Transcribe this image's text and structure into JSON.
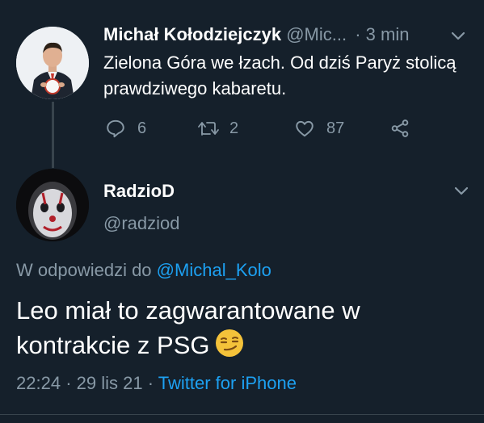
{
  "parent_tweet": {
    "author_name": "Michał Kołodziejczyk",
    "author_handle": "@Mic...",
    "time": "3 min",
    "text": "Zielona Góra we łzach. Od dziś Paryż stolicą prawdziwego kabaretu.",
    "replies": "6",
    "retweets": "2",
    "likes": "87"
  },
  "reply_tweet": {
    "author_name": "RadzioD",
    "author_handle": "@radziod",
    "reply_prefix": "W odpowiedzi do",
    "reply_to": "@Michal_Kolo",
    "text": "Leo miał to zagwarantowane w kontrakcie z PSG",
    "time": "22:24",
    "date": "29 lis 21",
    "source": "Twitter for iPhone",
    "separator": "·"
  },
  "colors": {
    "background": "#15202b",
    "muted": "#8899a6",
    "link": "#1da1f2",
    "divider": "#38444d"
  },
  "icons": [
    "chevron-down-icon",
    "reply-icon",
    "retweet-icon",
    "like-icon",
    "share-icon",
    "smirk-emoji"
  ]
}
